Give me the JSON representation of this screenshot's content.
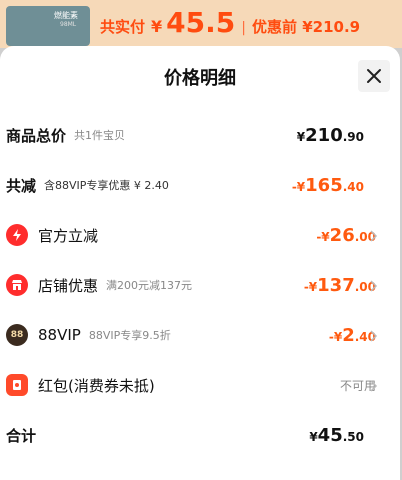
{
  "top": {
    "thumb_text_1": "燃能素",
    "thumb_text_2": "98ML",
    "paid_label": "共实付",
    "currency": "¥",
    "paid_amount": "45.5",
    "separator": "|",
    "before_label": "优惠前 ¥210.9"
  },
  "sheet": {
    "title": "价格明细"
  },
  "rows": {
    "total_goods": {
      "label": "商品总价",
      "sub": "共1件宝贝",
      "cur": "¥",
      "int": "210",
      "dec": ".90"
    },
    "total_discount": {
      "label": "共减",
      "sub": "含88VIP专享优惠 ¥ 2.40",
      "prefix": "-¥",
      "int": "165",
      "dec": ".40"
    },
    "official": {
      "label": "官方立减",
      "prefix": "-¥",
      "int": "26",
      "dec": ".00"
    },
    "store": {
      "label": "店铺优惠",
      "sub": "满200元减137元",
      "prefix": "-¥",
      "int": "137",
      "dec": ".00"
    },
    "vip": {
      "label": "88VIP",
      "sub": "88VIP专享9.5折",
      "prefix": "-¥",
      "int": "2",
      "dec": ".40",
      "icon_text": "88"
    },
    "redpacket": {
      "label": "红包(消费券未抵)",
      "status": "不可用"
    },
    "sum": {
      "label": "合计",
      "cur": "¥",
      "int": "45",
      "dec": ".50"
    }
  },
  "colors": {
    "accent": "#ff5a0f",
    "topbar": "#f6d9b8"
  },
  "icons": [
    "close-icon",
    "lightning-icon",
    "shop-icon",
    "vip88-icon",
    "red-packet-icon",
    "chevron-right-icon"
  ]
}
